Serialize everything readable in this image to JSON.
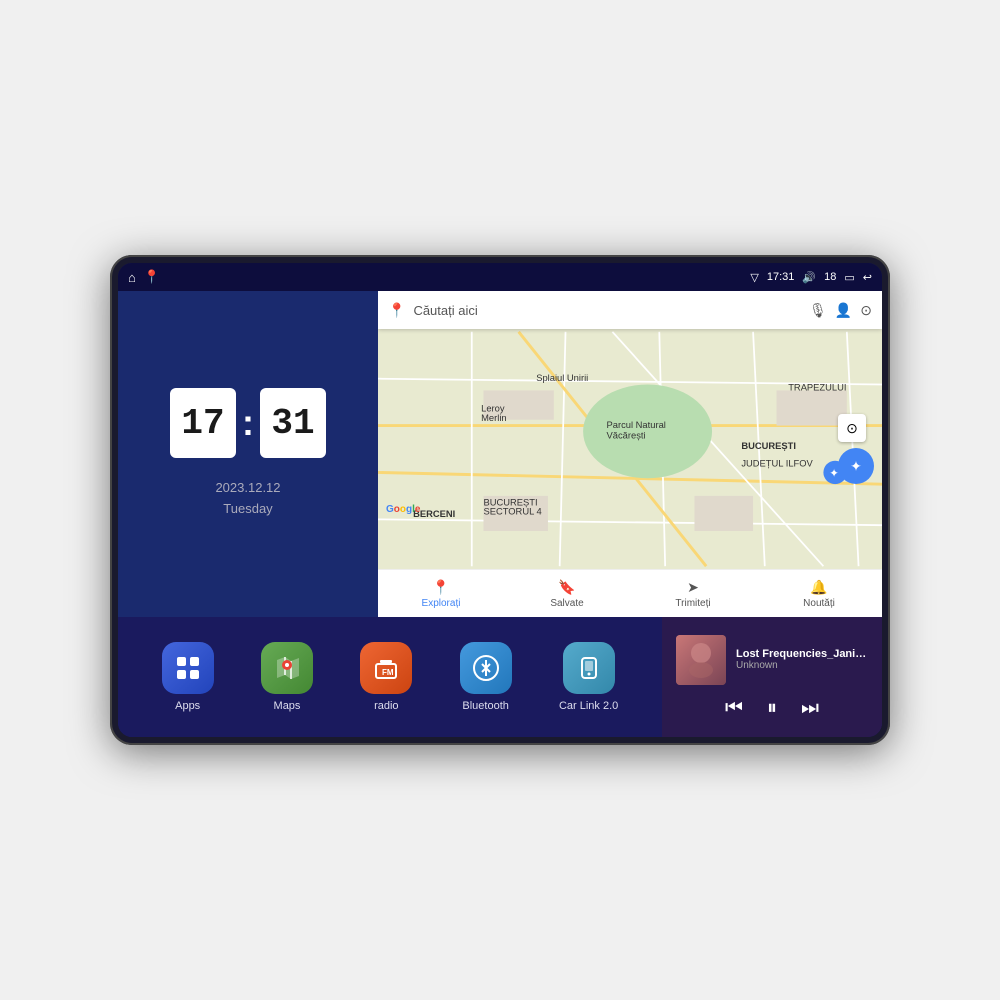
{
  "device": {
    "frame_color": "#1a1a2e"
  },
  "status_bar": {
    "time": "17:31",
    "battery": "18",
    "icons": [
      "location",
      "volume",
      "battery",
      "back"
    ]
  },
  "clock": {
    "hour": "17",
    "minute": "31",
    "date": "2023.12.12",
    "day": "Tuesday"
  },
  "map": {
    "search_placeholder": "Căutați aici",
    "tabs": [
      {
        "label": "Explorați",
        "icon": "📍",
        "active": true
      },
      {
        "label": "Salvate",
        "icon": "🔖",
        "active": false
      },
      {
        "label": "Trimiteți",
        "icon": "➤",
        "active": false
      },
      {
        "label": "Noutăți",
        "icon": "🔔",
        "active": false
      }
    ],
    "place_labels": [
      "Parcul Natural Văcărești",
      "BUCUREȘTI",
      "JUDEȚUL ILFOV",
      "TRAPEZULUI",
      "BERCENI",
      "Leroy Merlin",
      "BUCUREȘTI SECTORUL 4"
    ]
  },
  "apps": [
    {
      "label": "Apps",
      "icon": "⊞",
      "bg": "apps-icon-bg"
    },
    {
      "label": "Maps",
      "icon": "🗺",
      "bg": "maps-icon-bg"
    },
    {
      "label": "radio",
      "icon": "📻",
      "bg": "radio-icon-bg"
    },
    {
      "label": "Bluetooth",
      "icon": "⊞",
      "bg": "bluetooth-icon-bg"
    },
    {
      "label": "Car Link 2.0",
      "icon": "📱",
      "bg": "carlink-icon-bg"
    }
  ],
  "music": {
    "title": "Lost Frequencies_Janieck Devy-...",
    "artist": "Unknown",
    "controls": {
      "prev": "⏮",
      "play": "⏸",
      "next": "⏭"
    }
  }
}
